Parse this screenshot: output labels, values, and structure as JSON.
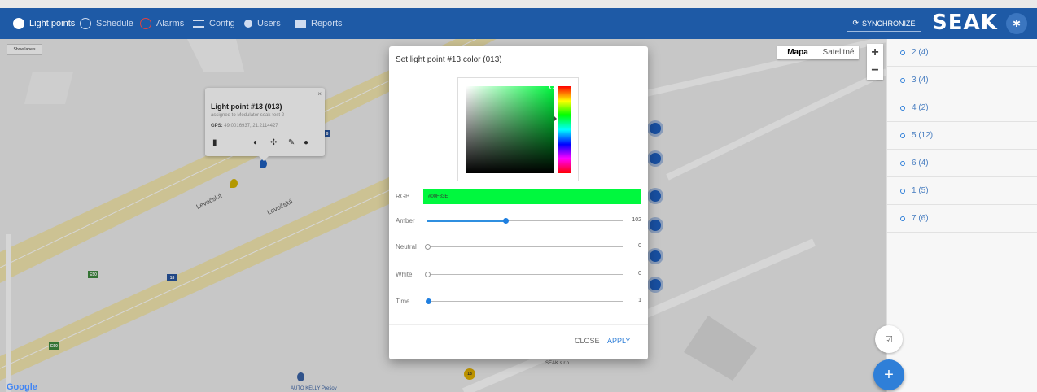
{
  "nav": {
    "items": [
      {
        "label": "Light points",
        "icon": "compass-icon",
        "active": true
      },
      {
        "label": "Schedule",
        "icon": "clock-icon",
        "active": false
      },
      {
        "label": "Alarms",
        "icon": "alarm-icon",
        "active": false
      },
      {
        "label": "Config",
        "icon": "sliders-icon",
        "active": false
      },
      {
        "label": "Users",
        "icon": "user-icon",
        "active": false
      },
      {
        "label": "Reports",
        "icon": "folder-icon",
        "active": false
      }
    ],
    "sync_label": "SYNCHRONIZE",
    "brand": "SEAK",
    "settings_icon": "gear-icon"
  },
  "map": {
    "show_labels": "Show labels",
    "map_type": [
      "Mapa",
      "Satelitné"
    ],
    "zoom_in": "+",
    "zoom_out": "−",
    "road_names": [
      "Levočská",
      "Levočská"
    ],
    "shields": [
      "E50",
      "18",
      "E50",
      "18",
      "8"
    ],
    "poi_labels": [
      "AUTO KELLY Prešov",
      "SEAK s.r.o.",
      "18"
    ],
    "google": "Google"
  },
  "popup": {
    "title": "Light point #13 (013)",
    "subtitle": "assigned to Modulator seak-test 2",
    "gps_label": "GPS:",
    "gps_value": "49.0016937, 21.2114427",
    "close": "×"
  },
  "dialog": {
    "title": "Set light point #13 color (013)",
    "rgb_label": "RGB",
    "rgb_value": "#00F83E",
    "color": "#00F83E",
    "sliders": [
      {
        "label": "Amber",
        "value": "102",
        "max": 255
      },
      {
        "label": "Neutral",
        "value": "0",
        "max": 255
      },
      {
        "label": "White",
        "value": "0",
        "max": 255
      },
      {
        "label": "Time",
        "value": "1",
        "max": 255
      }
    ],
    "close_label": "CLOSE",
    "apply_label": "APPLY"
  },
  "sidebar": {
    "groups": [
      "2 (4)",
      "3 (4)",
      "4 (2)",
      "5 (12)",
      "6 (4)",
      "1 (5)",
      "7 (6)"
    ]
  },
  "fab": {
    "small_icon": "checklist-icon",
    "main": "+"
  }
}
